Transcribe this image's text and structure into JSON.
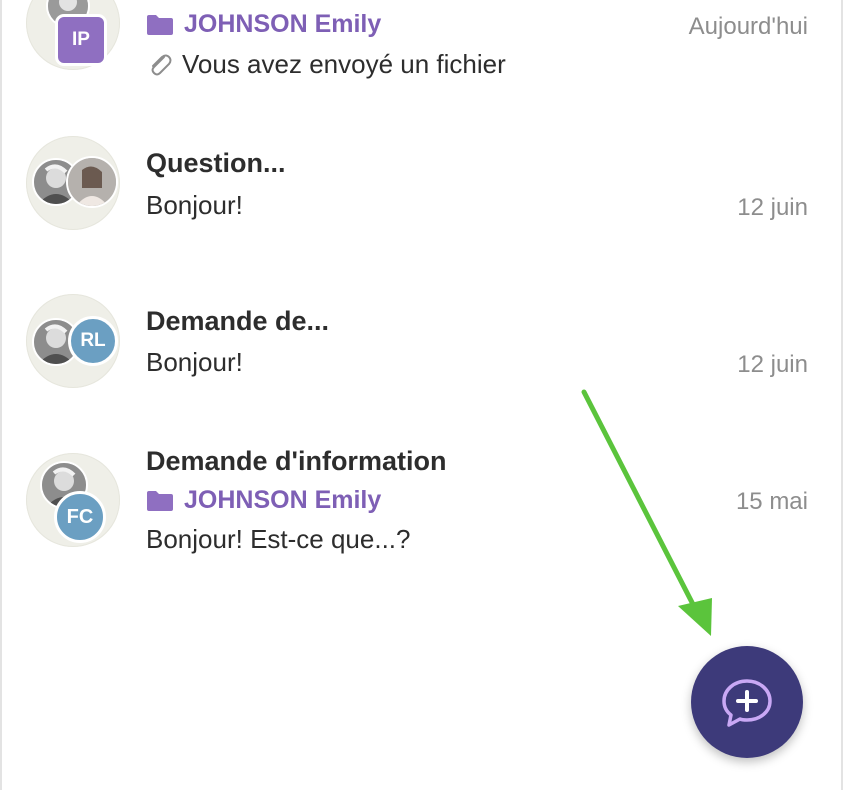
{
  "conversations": [
    {
      "folder": "JOHNSON Emily",
      "preview": "Vous avez envoyé un fichier",
      "date": "Aujourd'hui",
      "initials": "IP",
      "initials_color": "#8f6fc1"
    },
    {
      "title": "Question...",
      "preview": "Bonjour!",
      "date": "12 juin"
    },
    {
      "title": "Demande de...",
      "preview": "Bonjour!",
      "date": "12 juin",
      "initials": "RL",
      "initials_color": "#6b9fc2"
    },
    {
      "title": "Demande d'information",
      "folder": "JOHNSON Emily",
      "preview": "Bonjour! Est-ce que...?",
      "date": "15 mai",
      "initials": "FC",
      "initials_color": "#6b9fc2"
    }
  ],
  "icons": {
    "folder": "folder-icon",
    "attachment": "paperclip-icon",
    "new_message": "chat-plus-icon"
  },
  "colors": {
    "folder_accent": "#7e5fb5",
    "fab_background": "#3d3a7a",
    "annotation_arrow": "#5bc43c"
  }
}
